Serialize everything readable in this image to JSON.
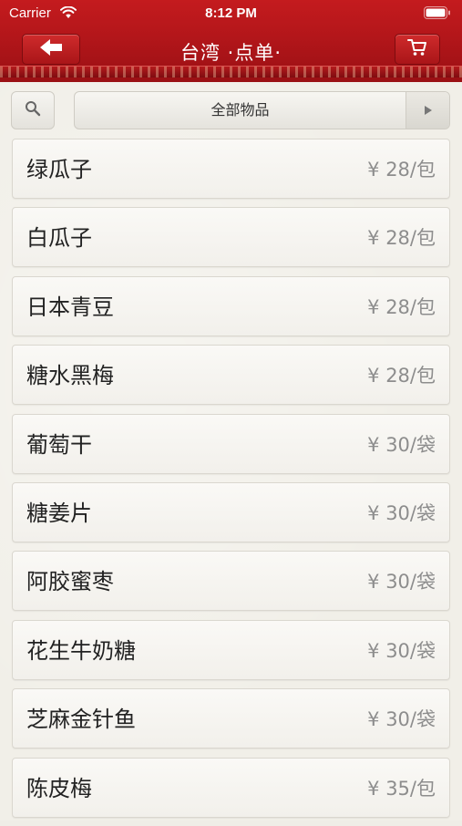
{
  "status_bar": {
    "carrier": "Carrier",
    "time": "8:12 PM"
  },
  "nav": {
    "title": "台湾 ·点单·",
    "back_icon": "back-arrow-icon",
    "cart_icon": "cart-icon",
    "bar_color": "#b3161a"
  },
  "filter": {
    "search_icon": "search-icon",
    "category": "全部物品",
    "arrow_icon": "play-arrow-icon"
  },
  "products": [
    {
      "name": "绿瓜子",
      "price": "¥ 28/包"
    },
    {
      "name": "白瓜子",
      "price": "¥ 28/包"
    },
    {
      "name": "日本青豆",
      "price": "¥ 28/包"
    },
    {
      "name": "糖水黑梅",
      "price": "¥ 28/包"
    },
    {
      "name": "葡萄干",
      "price": "¥ 30/袋"
    },
    {
      "name": "糖姜片",
      "price": "¥ 30/袋"
    },
    {
      "name": "阿胶蜜枣",
      "price": "¥ 30/袋"
    },
    {
      "name": "花生牛奶糖",
      "price": "¥ 30/袋"
    },
    {
      "name": "芝麻金针鱼",
      "price": "¥ 30/袋"
    },
    {
      "name": "陈皮梅",
      "price": "¥ 35/包"
    }
  ]
}
